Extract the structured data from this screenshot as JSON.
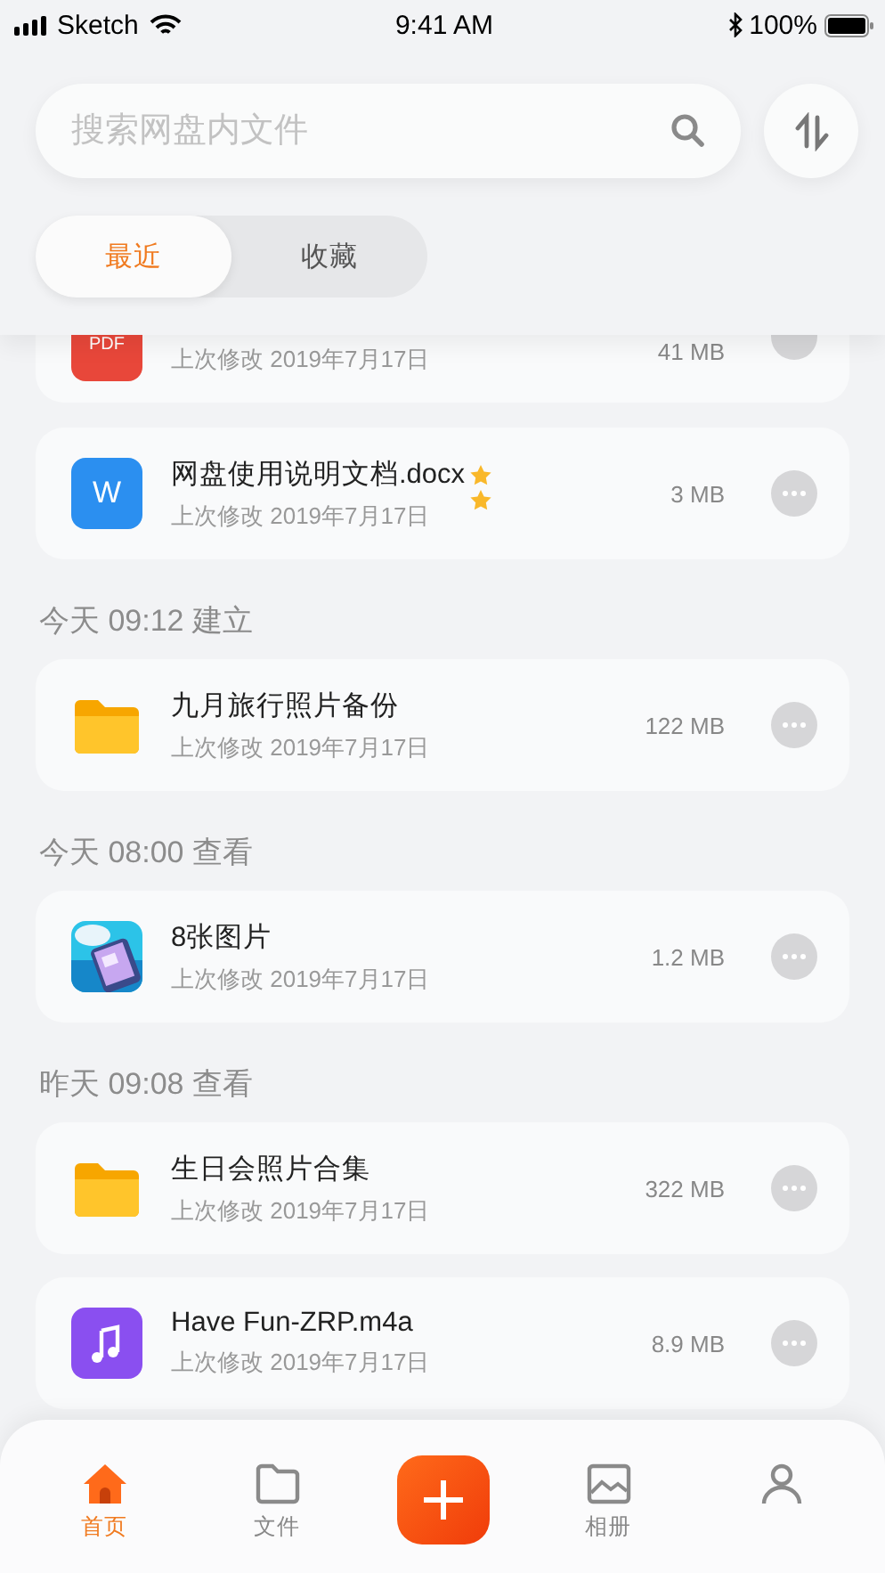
{
  "status_bar": {
    "carrier": "Sketch",
    "time": "9:41 AM",
    "battery": "100%"
  },
  "search": {
    "placeholder": "搜索网盘内文件"
  },
  "tabs": [
    {
      "label": "最近",
      "selected": true
    },
    {
      "label": "收藏",
      "selected": false
    }
  ],
  "groups": [
    {
      "items": [
        {
          "kind": "pdf",
          "badge": "PDF",
          "modified": "上次修改 2019年7月17日",
          "size": "41 MB"
        },
        {
          "kind": "word",
          "badge": "W",
          "name": "网盘使用说明文档.docx",
          "modified": "上次修改 2019年7月17日",
          "size": "3 MB",
          "starred": true
        }
      ]
    },
    {
      "heading": "今天 09:12 建立",
      "items": [
        {
          "kind": "folder",
          "name": "九月旅行照片备份",
          "modified": "上次修改 2019年7月17日",
          "size": "122 MB",
          "starred": false
        }
      ]
    },
    {
      "heading": "今天 08:00 查看",
      "items": [
        {
          "kind": "photos",
          "name": "8张图片",
          "modified": "上次修改 2019年7月17日",
          "size": "1.2 MB",
          "starred": false
        }
      ]
    },
    {
      "heading": "昨天 09:08 查看",
      "items": [
        {
          "kind": "folder",
          "name": "生日会照片合集",
          "modified": "上次修改 2019年7月17日",
          "size": "322 MB",
          "starred": false
        },
        {
          "kind": "music",
          "name": "Have Fun-ZRP.m4a",
          "modified": "上次修改 2019年7月17日",
          "size": "8.9 MB",
          "starred": false
        }
      ]
    }
  ],
  "tab_bar": [
    {
      "kind": "home",
      "label": "首页",
      "selected": true
    },
    {
      "kind": "folder",
      "label": "文件",
      "selected": false
    },
    {
      "kind": "add"
    },
    {
      "kind": "album",
      "label": "相册",
      "selected": false
    },
    {
      "kind": "profile",
      "selected": false
    }
  ]
}
